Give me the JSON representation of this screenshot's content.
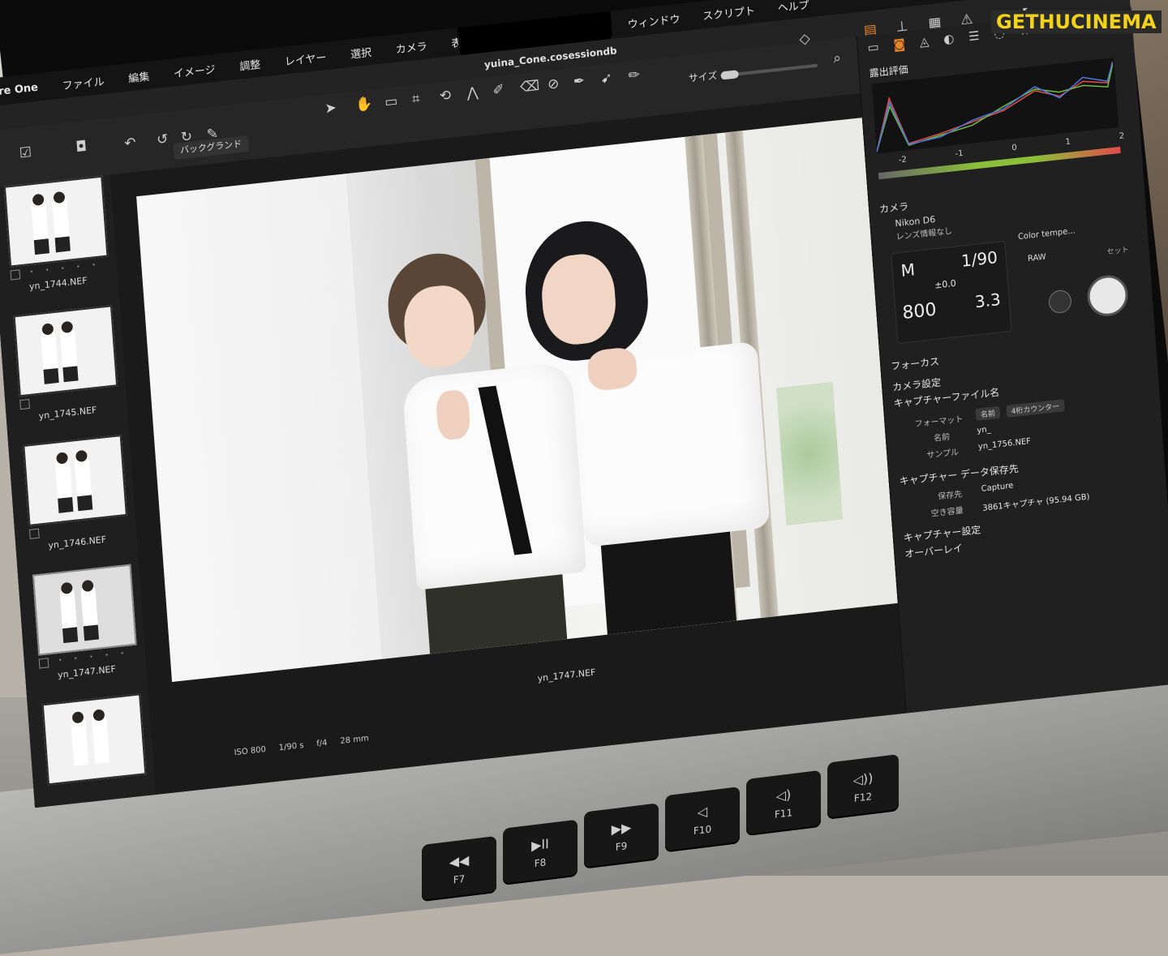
{
  "watermark": "GETHUCINEMA",
  "menubar": {
    "app": "re One",
    "items_left": [
      "ファイル",
      "編集",
      "イメージ",
      "調整",
      "レイヤー",
      "選択",
      "カメラ",
      "表示"
    ],
    "items_right": [
      "ウィンドウ",
      "スクリプト",
      "ヘルプ"
    ]
  },
  "titlebar": {
    "title": "yuina_Cone.cosessiondb"
  },
  "toolbar": {
    "size_label": "サイズ",
    "background_select": "バックグランド"
  },
  "browser": {
    "thumbnails": [
      {
        "name": "yn_1744.NEF",
        "selected": false
      },
      {
        "name": "yn_1745.NEF",
        "selected": false
      },
      {
        "name": "yn_1746.NEF",
        "selected": false
      },
      {
        "name": "yn_1747.NEF",
        "selected": true
      },
      {
        "name": "",
        "selected": false
      }
    ],
    "rating_dots": "• • • • •"
  },
  "viewer": {
    "filename": "yn_1747.NEF",
    "exif": {
      "iso": "ISO 800",
      "shutter": "1/90 s",
      "aperture": "f/4",
      "focal": "28 mm"
    }
  },
  "panel": {
    "exposure_title": "露出評価",
    "scale_labels": [
      "-2",
      "-1",
      "0",
      "1",
      "2"
    ],
    "camera_title": "カメラ",
    "camera_model": "Nikon D6",
    "lens_info": "レンズ情報なし",
    "mode": "M",
    "shutter": "1/90",
    "ev": "±0.0",
    "iso": "800",
    "aperture": "3.3",
    "kelvin_label": "Color tempe...",
    "raw_label": "RAW",
    "set_label": "セット",
    "focus_title": "フォーカス",
    "camera_settings_title": "カメラ設定",
    "capture_name_title": "キャプチャーファイル名",
    "format_label": "フォーマット",
    "format_pill1": "名前",
    "format_pill2": "4桁カウンター",
    "name_label": "名前",
    "name_value": "yn_",
    "sample_label": "サンプル",
    "sample_value": "yn_1756.NEF",
    "capture_location_title": "キャプチャー データ保存先",
    "save_label": "保存先",
    "save_value": "Capture",
    "free_label": "空き容量",
    "free_value": "3861キャプチャ (95.94 GB)",
    "capture_settings_title": "キャプチャー設定",
    "overlay_title": "オーバーレイ"
  },
  "keyboard": {
    "keys": [
      {
        "label": "F7",
        "symbol": "◀◀"
      },
      {
        "label": "F8",
        "symbol": "▶II"
      },
      {
        "label": "F9",
        "symbol": "▶▶"
      },
      {
        "label": "F10",
        "symbol": "◁"
      },
      {
        "label": "F11",
        "symbol": "◁)"
      },
      {
        "label": "F12",
        "symbol": "◁))"
      }
    ]
  }
}
